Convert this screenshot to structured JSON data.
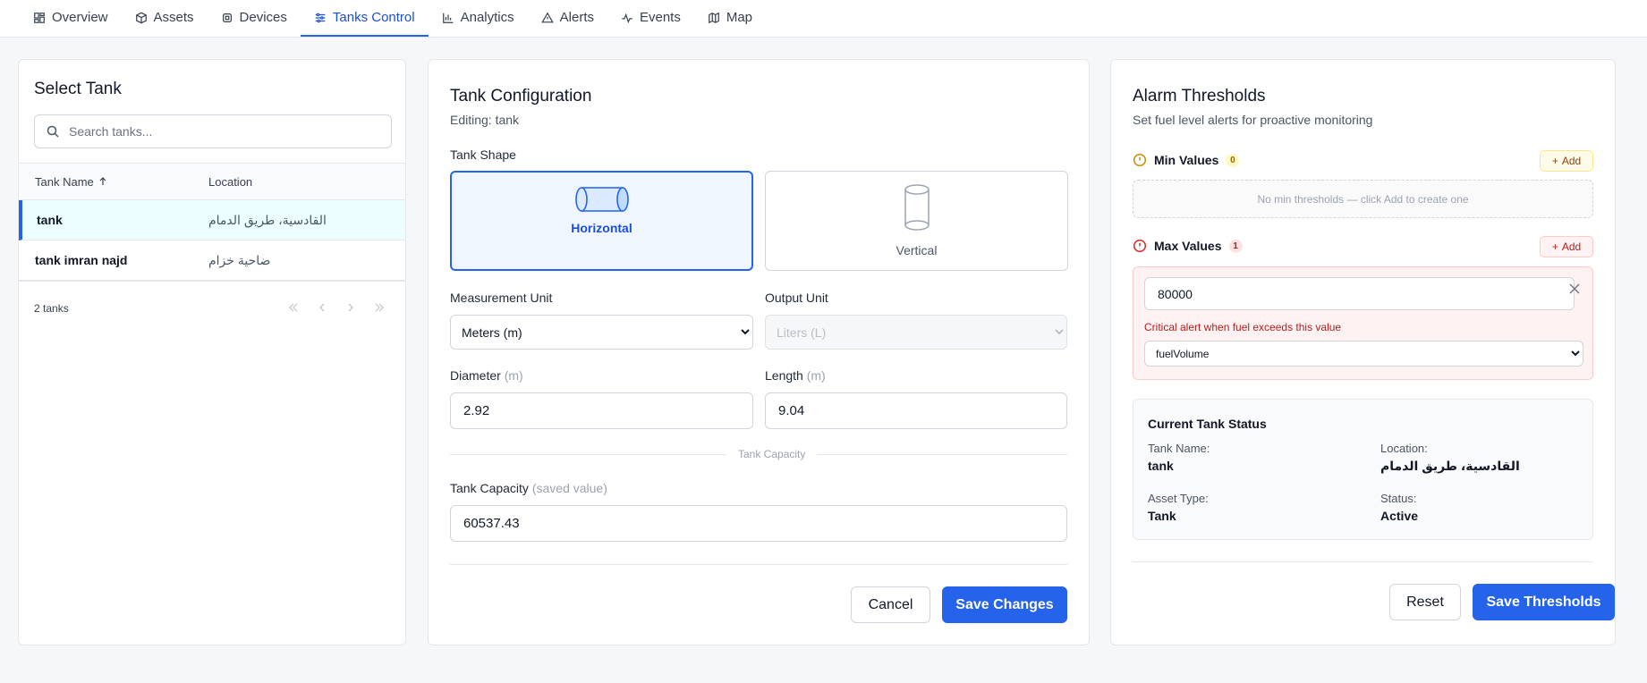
{
  "nav": {
    "tabs": [
      {
        "label": "Overview",
        "icon": "dashboard-icon"
      },
      {
        "label": "Assets",
        "icon": "box-icon"
      },
      {
        "label": "Devices",
        "icon": "device-icon"
      },
      {
        "label": "Tanks Control",
        "icon": "sliders-icon"
      },
      {
        "label": "Analytics",
        "icon": "bar-chart-icon"
      },
      {
        "label": "Alerts",
        "icon": "warning-icon"
      },
      {
        "label": "Events",
        "icon": "activity-icon"
      },
      {
        "label": "Map",
        "icon": "map-icon"
      }
    ],
    "active": "Tanks Control"
  },
  "select_tank": {
    "title": "Select Tank",
    "search_placeholder": "Search tanks...",
    "columns": [
      "Tank Name",
      "Location"
    ],
    "rows": [
      {
        "name": "tank",
        "location": "القادسية، طريق الدمام"
      },
      {
        "name": "tank imran najd",
        "location": "ضاحية خزام"
      }
    ],
    "count": "2 tanks"
  },
  "config": {
    "title": "Tank Configuration",
    "editing": "Editing: tank",
    "shape_label": "Tank Shape",
    "shapes": {
      "horizontal": "Horizontal",
      "vertical": "Vertical"
    },
    "selected_shape": "Horizontal",
    "measurement_label": "Measurement Unit",
    "measurement_value": "Meters (m)",
    "output_label": "Output Unit",
    "output_value": "Liters (L)",
    "diameter_label": "Diameter",
    "diameter_unit": "(m)",
    "diameter_value": "2.92",
    "length_label": "Length",
    "length_unit": "(m)",
    "length_value": "9.04",
    "divider_label": "Tank Capacity",
    "capacity_label": "Tank Capacity",
    "capacity_note": "(saved value)",
    "capacity_value": "60537.43",
    "cancel": "Cancel",
    "save": "Save Changes"
  },
  "alarms": {
    "title": "Alarm Thresholds",
    "subtitle": "Set fuel level alerts for proactive monitoring",
    "min_label": "Min Values",
    "min_count": "0",
    "add_label": "Add",
    "min_empty": "No min thresholds — click Add to create one",
    "max_label": "Max Values",
    "max_count": "1",
    "max_value": "80000",
    "max_hint": "Critical alert when fuel exceeds this value",
    "max_field": "fuelVolume",
    "status_title": "Current Tank Status",
    "status": {
      "name_k": "Tank Name:",
      "name_v": "tank",
      "loc_k": "Location:",
      "loc_v": "القادسية، طريق الدمام",
      "type_k": "Asset Type:",
      "type_v": "Tank",
      "state_k": "Status:",
      "state_v": "Active"
    },
    "reset": "Reset",
    "save": "Save Thresholds"
  },
  "colors": {
    "primary": "#2563eb",
    "danger": "#dc2626",
    "warning": "#ca8a04"
  }
}
